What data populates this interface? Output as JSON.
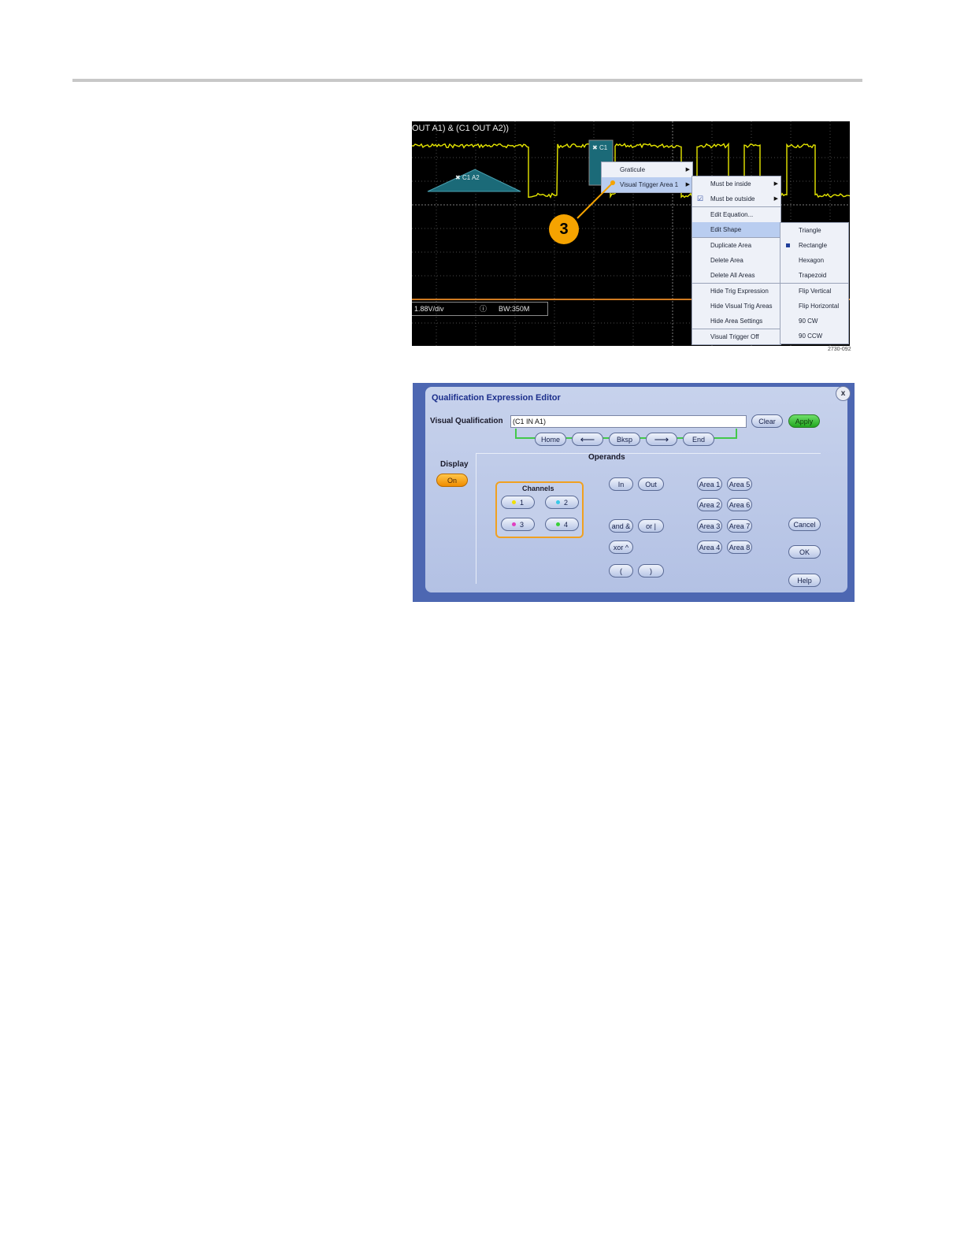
{
  "scope": {
    "title": "OUT A1) & (C1 OUT A2))",
    "area_label_triangle": "C1 A2",
    "area_label_rect": "C1",
    "readout_volts": "1.88V/div",
    "readout_info": "ⓘ",
    "readout_bw": "BW:350M",
    "callout_number": "3",
    "figure_number": "2730-092",
    "menu1": {
      "items": [
        "Graticule",
        "Visual Trigger Area 1"
      ]
    },
    "menu2": {
      "items": [
        "Must be inside",
        "Must be outside",
        "Edit Equation...",
        "Edit Shape",
        "Duplicate Area",
        "Delete Area",
        "Delete All Areas",
        "Hide Trig Expression",
        "Hide Visual Trig Areas",
        "Hide Area Settings",
        "Visual Trigger Off"
      ]
    },
    "menu3": {
      "items": [
        "Triangle",
        "Rectangle",
        "Hexagon",
        "Trapezoid",
        "Flip Vertical",
        "Flip Horizontal",
        "90 CW",
        "90 CCW"
      ]
    },
    "colors": {
      "waveform": "#e6e600",
      "area": "#1b6a78",
      "callout": "#f5a300"
    }
  },
  "editor": {
    "title": "Qualification Expression Editor",
    "close": "x",
    "vq_label": "Visual Qualification",
    "vq_value": "(C1 IN A1)",
    "clear": "Clear",
    "apply": "Apply",
    "nav": {
      "home": "Home",
      "left": "⟵",
      "bksp": "Bksp",
      "right": "⟶",
      "end": "End"
    },
    "display_label": "Display",
    "display_value": "On",
    "operands_label": "Operands",
    "channels_label": "Channels",
    "channels": [
      "1",
      "2",
      "3",
      "4"
    ],
    "channel_colors": [
      "#f0e000",
      "#38c8e8",
      "#e040c0",
      "#38d038"
    ],
    "ops": {
      "in": "In",
      "out": "Out",
      "and": "and &",
      "or": "or |",
      "xor": "xor ^",
      "lparen": "(",
      "rparen": ")"
    },
    "areas": [
      "Area 1",
      "Area 2",
      "Area 3",
      "Area 4",
      "Area 5",
      "Area 6",
      "Area 7",
      "Area 8"
    ],
    "cancel": "Cancel",
    "ok": "OK",
    "help": "Help"
  }
}
